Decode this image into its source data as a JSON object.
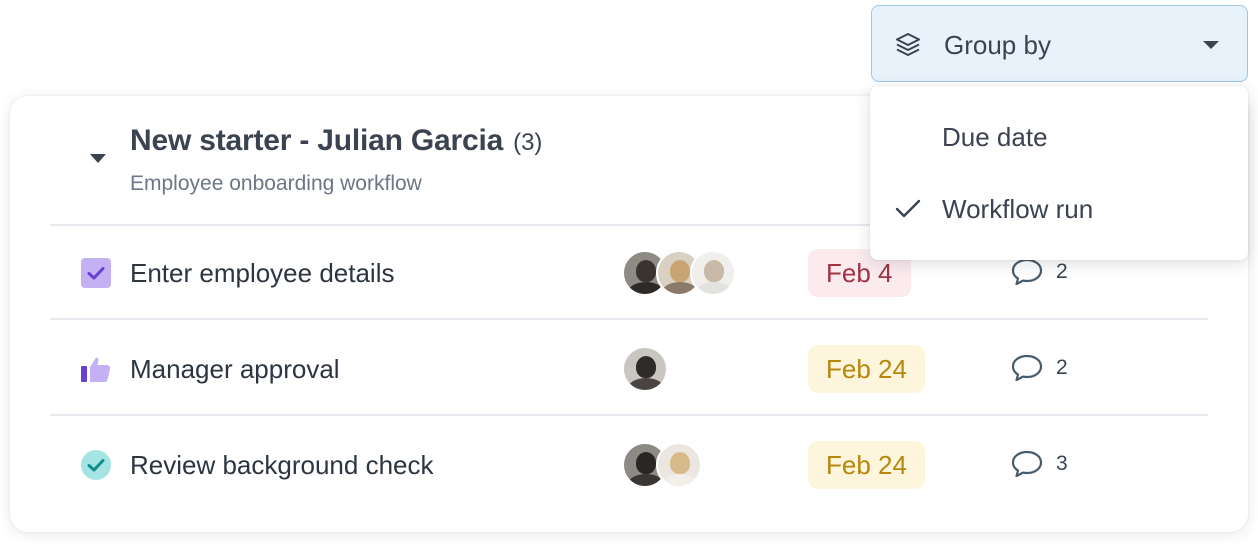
{
  "group_by": {
    "label": "Group by",
    "icon": "layers-icon",
    "options": [
      {
        "label": "Due date",
        "selected": false
      },
      {
        "label": "Workflow run",
        "selected": true
      }
    ]
  },
  "group": {
    "title": "New starter - Julian Garcia",
    "count": "(3)",
    "subtitle": "Employee onboarding workflow"
  },
  "tasks": [
    {
      "name": "Enter employee details",
      "icon": "checkbox-checked-icon",
      "avatars": 3,
      "due": "Feb 4",
      "due_bg": "#fbebee",
      "due_color": "#a13344",
      "comments": "2"
    },
    {
      "name": "Manager approval",
      "icon": "thumbs-up-icon",
      "avatars": 1,
      "due": "Feb 24",
      "due_bg": "#fdf6dd",
      "due_color": "#b8860b",
      "comments": "2"
    },
    {
      "name": "Review background check",
      "icon": "check-circle-icon",
      "avatars": 2,
      "due": "Feb 24",
      "due_bg": "#fdf6dd",
      "due_color": "#b8860b",
      "comments": "3"
    }
  ]
}
